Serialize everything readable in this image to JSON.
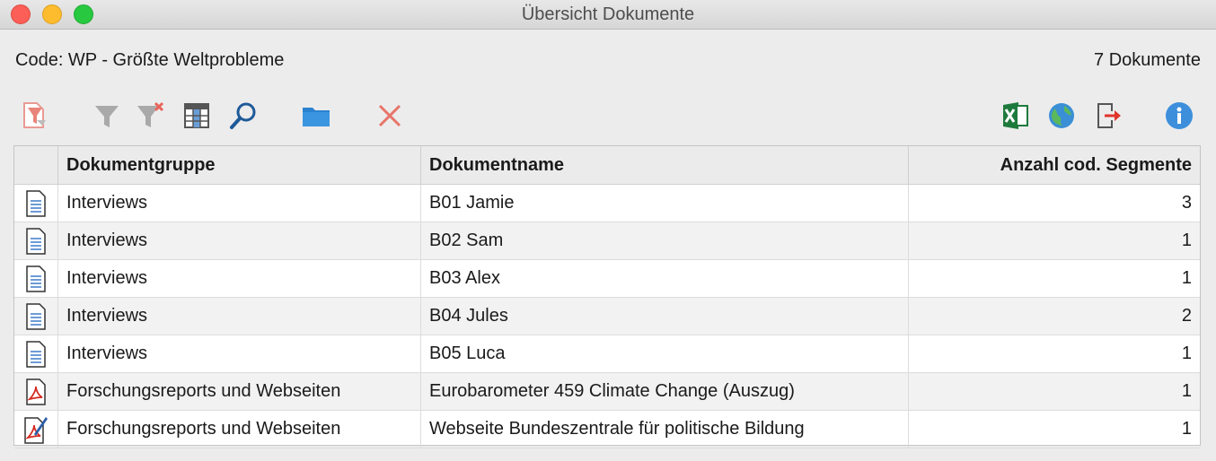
{
  "window": {
    "title": "Übersicht Dokumente"
  },
  "header": {
    "code_label": "Code: WP - Größte Weltprobleme",
    "doc_count": "7 Dokumente"
  },
  "toolbar": {
    "icons": [
      "filter-documents-icon",
      "filter-icon",
      "clear-filter-icon",
      "columns-icon",
      "search-icon",
      "folder-icon",
      "delete-icon",
      "excel-export-icon",
      "web-export-icon",
      "export-icon",
      "info-icon"
    ]
  },
  "table": {
    "headers": [
      "Dokumentgruppe",
      "Dokumentname",
      "Anzahl cod. Segmente"
    ],
    "rows": [
      {
        "icon": "text-document-icon",
        "group": "Interviews",
        "name": "B01 Jamie",
        "count": "3"
      },
      {
        "icon": "text-document-icon",
        "group": "Interviews",
        "name": "B02 Sam",
        "count": "1"
      },
      {
        "icon": "text-document-icon",
        "group": "Interviews",
        "name": "B03 Alex",
        "count": "1"
      },
      {
        "icon": "text-document-icon",
        "group": "Interviews",
        "name": "B04 Jules",
        "count": "2"
      },
      {
        "icon": "text-document-icon",
        "group": "Interviews",
        "name": "B05 Luca",
        "count": "1"
      },
      {
        "icon": "pdf-document-icon",
        "group": "Forschungsreports und Webseiten",
        "name": "Eurobarometer 459 Climate Change (Auszug)",
        "count": "1"
      },
      {
        "icon": "pdf-edit-document-icon",
        "group": "Forschungsreports und Webseiten",
        "name": "Webseite Bundeszentrale für politische Bildung",
        "count": "1"
      }
    ]
  },
  "colors": {
    "excel": "#1e7a3c",
    "info": "#3d8fdc",
    "folder": "#2b82d0",
    "delete": "#e8756b"
  }
}
